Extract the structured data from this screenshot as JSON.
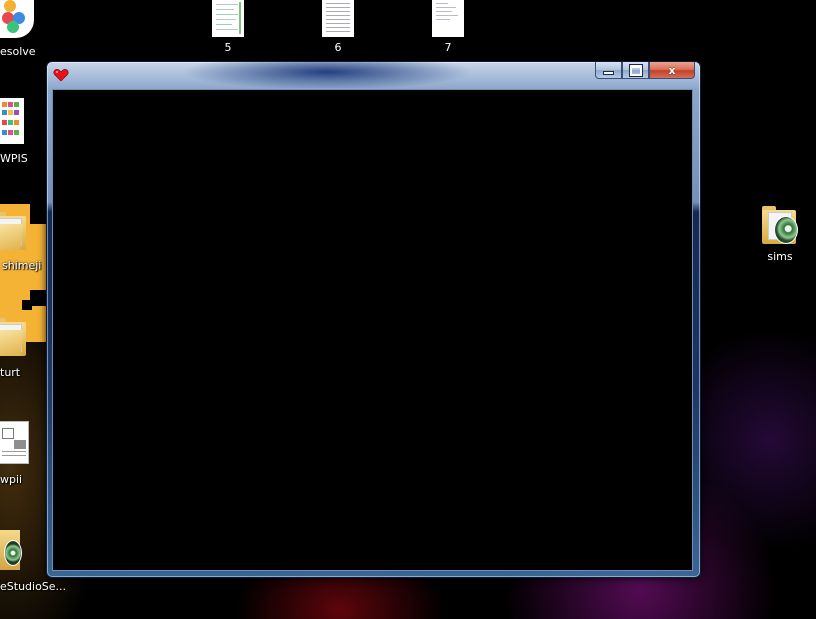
{
  "desktop": {
    "left_icons": [
      {
        "label": "esolve",
        "icon": "davinci-resolve-icon"
      },
      {
        "label": "WPIS",
        "icon": "document-thumbnail-icon"
      },
      {
        "label": "shimeji",
        "icon": "folder-icon"
      },
      {
        "label": "turt",
        "icon": "folder-icon"
      },
      {
        "label": "wpii",
        "icon": "document-icon"
      },
      {
        "label": "eStudioSe...",
        "icon": "disc-folder-icon"
      }
    ],
    "top_icons": [
      {
        "label": "5",
        "icon": "document-thumbnail-icon"
      },
      {
        "label": "6",
        "icon": "document-thumbnail-icon"
      },
      {
        "label": "7",
        "icon": "document-thumbnail-icon"
      }
    ],
    "right_icons": [
      {
        "label": "sims",
        "icon": "disc-folder-icon"
      }
    ]
  },
  "window": {
    "app_icon": "red-heart-icon",
    "title": "",
    "caption_buttons": {
      "minimize": "minimize-icon",
      "maximize": "maximize-icon",
      "close_label": "x"
    },
    "client_background": "#000000"
  },
  "colors": {
    "desktop_background": "#000000",
    "close_button": "#c2412b",
    "heart": "#e8101b"
  }
}
